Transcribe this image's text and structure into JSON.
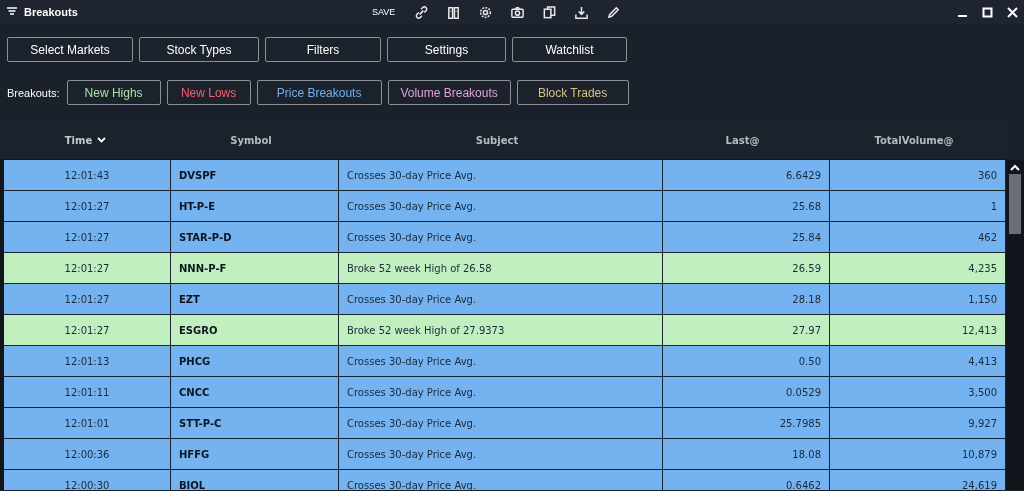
{
  "window": {
    "title": "Breakouts",
    "save_label": "SAVE"
  },
  "toolbar_buttons": [
    {
      "label": "Select Markets"
    },
    {
      "label": "Stock Types"
    },
    {
      "label": "Filters"
    },
    {
      "label": "Settings"
    },
    {
      "label": "Watchlist"
    }
  ],
  "breakouts": {
    "label": "Breakouts:",
    "buttons": [
      {
        "label": "New Highs",
        "color": "#a8e0a0"
      },
      {
        "label": "New Lows",
        "color": "#f06070"
      },
      {
        "label": "Price Breakouts",
        "color": "#70b0f0"
      },
      {
        "label": "Volume Breakouts",
        "color": "#e0a0d8"
      },
      {
        "label": "Block Trades",
        "color": "#d8c080"
      }
    ]
  },
  "table": {
    "columns": [
      {
        "label": "Time",
        "sorted": true
      },
      {
        "label": "Symbol",
        "sorted": false
      },
      {
        "label": "Subject",
        "sorted": false
      },
      {
        "label": "Last@",
        "sorted": false
      },
      {
        "label": "TotalVolume@",
        "sorted": false
      }
    ],
    "rows": [
      {
        "color": "#74b2f0",
        "cells": [
          "12:01:43",
          "DVSPF",
          "Crosses 30-day Price Avg.",
          "6.6429",
          "360"
        ]
      },
      {
        "color": "#74b2f0",
        "cells": [
          "12:01:27",
          "HT-P-E",
          "Crosses 30-day Price Avg.",
          "25.68",
          "1"
        ]
      },
      {
        "color": "#74b2f0",
        "cells": [
          "12:01:27",
          "STAR-P-D",
          "Crosses 30-day Price Avg.",
          "25.84",
          "462"
        ]
      },
      {
        "color": "#c2efc0",
        "cells": [
          "12:01:27",
          "NNN-P-F",
          "Broke 52 week High of 26.58",
          "26.59",
          "4,235"
        ]
      },
      {
        "color": "#74b2f0",
        "cells": [
          "12:01:27",
          "EZT",
          "Crosses 30-day Price Avg.",
          "28.18",
          "1,150"
        ]
      },
      {
        "color": "#c2efc0",
        "cells": [
          "12:01:27",
          "ESGRO",
          "Broke 52 week High of 27.9373",
          "27.97",
          "12,413"
        ]
      },
      {
        "color": "#74b2f0",
        "cells": [
          "12:01:13",
          "PHCG",
          "Crosses 30-day Price Avg.",
          "0.50",
          "4,413"
        ]
      },
      {
        "color": "#74b2f0",
        "cells": [
          "12:01:11",
          "CNCC",
          "Crosses 30-day Price Avg.",
          "0.0529",
          "3,500"
        ]
      },
      {
        "color": "#74b2f0",
        "cells": [
          "12:01:01",
          "STT-P-C",
          "Crosses 30-day Price Avg.",
          "25.7985",
          "9,927"
        ]
      },
      {
        "color": "#74b2f0",
        "cells": [
          "12:00:36",
          "HFFG",
          "Crosses 30-day Price Avg.",
          "18.08",
          "10,879"
        ]
      },
      {
        "color": "#74b2f0",
        "cells": [
          "12:00:30",
          "BIOL",
          "Crosses 30-day Price Avg.",
          "0.6462",
          "24,619"
        ]
      }
    ]
  }
}
